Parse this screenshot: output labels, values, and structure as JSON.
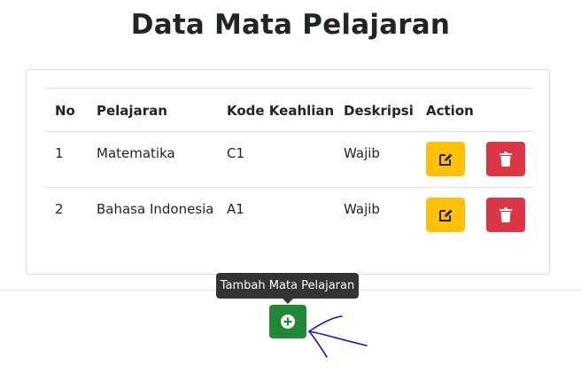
{
  "page": {
    "title": "Data Mata Pelajaran"
  },
  "table": {
    "headers": {
      "no": "No",
      "pelajaran": "Pelajaran",
      "kode": "Kode Keahlian",
      "deskripsi": "Deskripsi",
      "action": "Action"
    },
    "rows": [
      {
        "no": "1",
        "pelajaran": "Matematika",
        "kode": "C1",
        "deskripsi": "Wajib"
      },
      {
        "no": "2",
        "pelajaran": "Bahasa Indonesia",
        "kode": "A1",
        "deskripsi": "Wajib"
      }
    ],
    "edit_icon": "edit-icon",
    "delete_icon": "trash-icon"
  },
  "add_button": {
    "tooltip": "Tambah Mata Pelajaran",
    "icon": "plus-circle-icon"
  },
  "colors": {
    "edit": "#ffc107",
    "delete": "#dc3545",
    "add": "#218838",
    "tooltip_bg": "#333333",
    "annotation": "#1010e0"
  }
}
